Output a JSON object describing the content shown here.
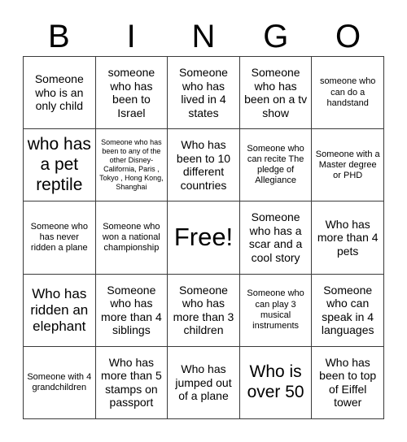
{
  "card": {
    "title_letters": [
      "B",
      "I",
      "N",
      "G",
      "O"
    ],
    "grid": {
      "columns": 5,
      "rows": 5,
      "border_color": "#3a3a3a",
      "background_color": "#ffffff",
      "text_color": "#000000"
    },
    "cells": [
      {
        "text": "Someone who is an only child",
        "size": "md"
      },
      {
        "text": "someone who has been to Israel",
        "size": "md"
      },
      {
        "text": "Someone who has lived in 4 states",
        "size": "md"
      },
      {
        "text": "Someone who has been on a tv show",
        "size": "md"
      },
      {
        "text": "someone who can do a handstand",
        "size": "sm"
      },
      {
        "text": "who has a pet reptile",
        "size": "xl"
      },
      {
        "text": "Someone who has been to any of the other Disney- California, Paris , Tokyo , Hong Kong, Shanghai",
        "size": "xs"
      },
      {
        "text": "Who has been to 10 different countries",
        "size": "md"
      },
      {
        "text": "Someone who can recite The pledge of Allegiance",
        "size": "sm"
      },
      {
        "text": "Someone with a Master degree or PHD",
        "size": "sm"
      },
      {
        "text": "Someone who has never ridden a plane",
        "size": "sm"
      },
      {
        "text": "Someone who won a national championship",
        "size": "sm"
      },
      {
        "text": "Free!",
        "size": "free"
      },
      {
        "text": "Someone who has a scar and a cool story",
        "size": "md"
      },
      {
        "text": "Who has more than 4 pets",
        "size": "md"
      },
      {
        "text": "Who has ridden an elephant",
        "size": "lg"
      },
      {
        "text": "Someone who has more than 4 siblings",
        "size": "md"
      },
      {
        "text": "Someone who has more than 3 children",
        "size": "md"
      },
      {
        "text": "Someone who can play 3 musical instruments",
        "size": "sm"
      },
      {
        "text": "Someone who can speak in 4 languages",
        "size": "md"
      },
      {
        "text": "Someone with 4 grandchildren",
        "size": "sm"
      },
      {
        "text": "Who has more than 5 stamps on passport",
        "size": "md"
      },
      {
        "text": "Who has jumped out of a plane",
        "size": "md"
      },
      {
        "text": "Who is over 50",
        "size": "xl"
      },
      {
        "text": "Who has been to top of Eiffel tower",
        "size": "md"
      }
    ]
  }
}
